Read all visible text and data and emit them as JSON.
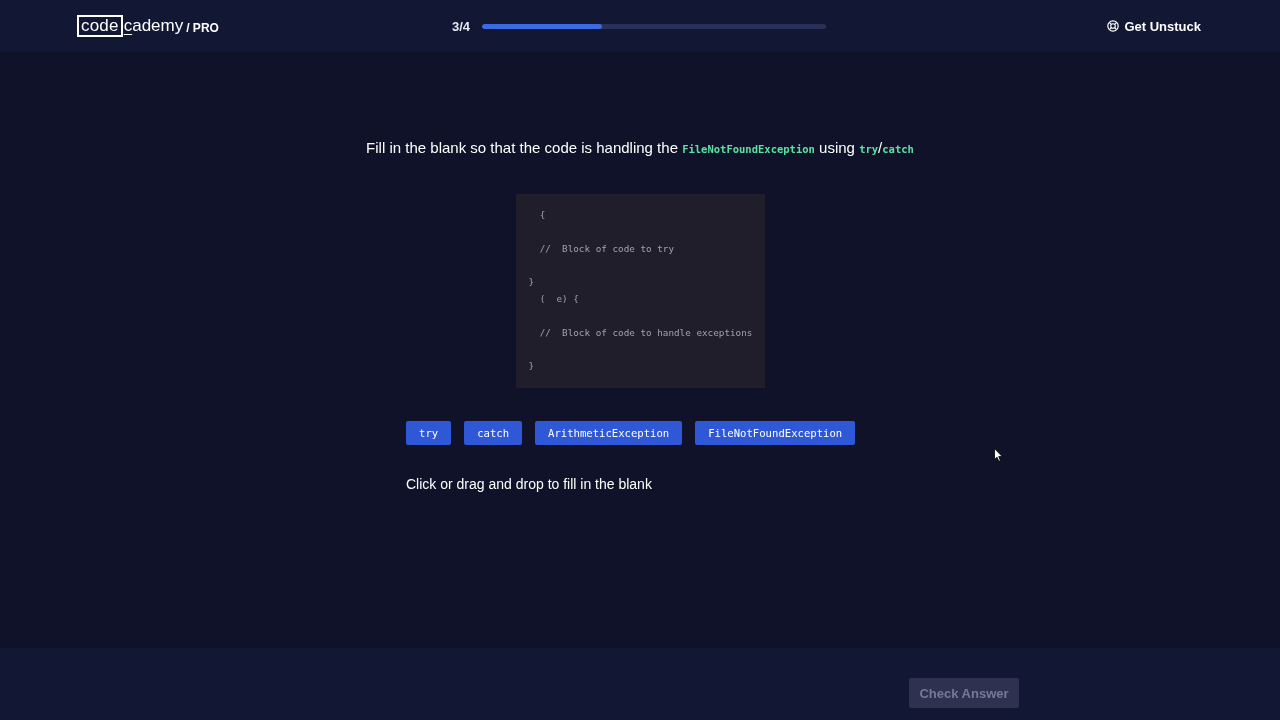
{
  "header": {
    "logo": {
      "boxed": "code",
      "rest": "cademy",
      "plan": "/ PRO"
    },
    "progress": {
      "counter": "3/4",
      "level": 0.35
    },
    "help_link": "Get Unstuck"
  },
  "question": [
    {
      "kind": "text",
      "text": "Fill in the blank so that the code is handling the "
    },
    {
      "kind": "code",
      "text": "FileNotFoundException"
    },
    {
      "kind": "text",
      "text": " using "
    },
    {
      "kind": "code",
      "text": "try"
    },
    {
      "kind": "text",
      "text": "/"
    },
    {
      "kind": "code",
      "text": "catch"
    }
  ],
  "code_block": [
    {
      "kind": "code",
      "text": "  {"
    },
    {
      "kind": "blank"
    },
    {
      "kind": "code",
      "text": "  //  Block of code to try"
    },
    {
      "kind": "blank"
    },
    {
      "kind": "code",
      "text": "}"
    },
    {
      "kind": "code",
      "text": "  (  e) {"
    },
    {
      "kind": "blank"
    },
    {
      "kind": "code",
      "text": "  //  Block of code to handle exceptions"
    },
    {
      "kind": "blank"
    },
    {
      "kind": "code",
      "text": "}"
    }
  ],
  "choices": [
    "try",
    "catch",
    "ArithmeticException",
    "FileNotFoundException"
  ],
  "instruction": "Click or drag and drop to fill in the blank",
  "footer": {
    "check_button": {
      "label": "Check Answer",
      "disabled": true
    }
  }
}
